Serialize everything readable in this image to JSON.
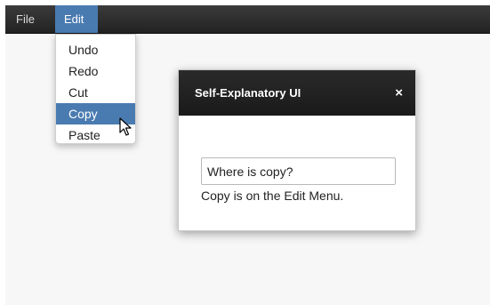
{
  "menubar": {
    "file_label": "File",
    "edit_label": "Edit"
  },
  "edit_menu": {
    "items": [
      "Undo",
      "Redo",
      "Cut",
      "Copy",
      "Paste"
    ],
    "selected": "Copy"
  },
  "dialog": {
    "title": "Self-Explanatory UI",
    "close_glyph": "×",
    "input_value": "Where is copy?",
    "message": "Copy is on the Edit Menu."
  },
  "colors": {
    "accent": "#4a7bb0",
    "menubar": "#2e2e2e",
    "dialog_header": "#1f1f1f"
  }
}
